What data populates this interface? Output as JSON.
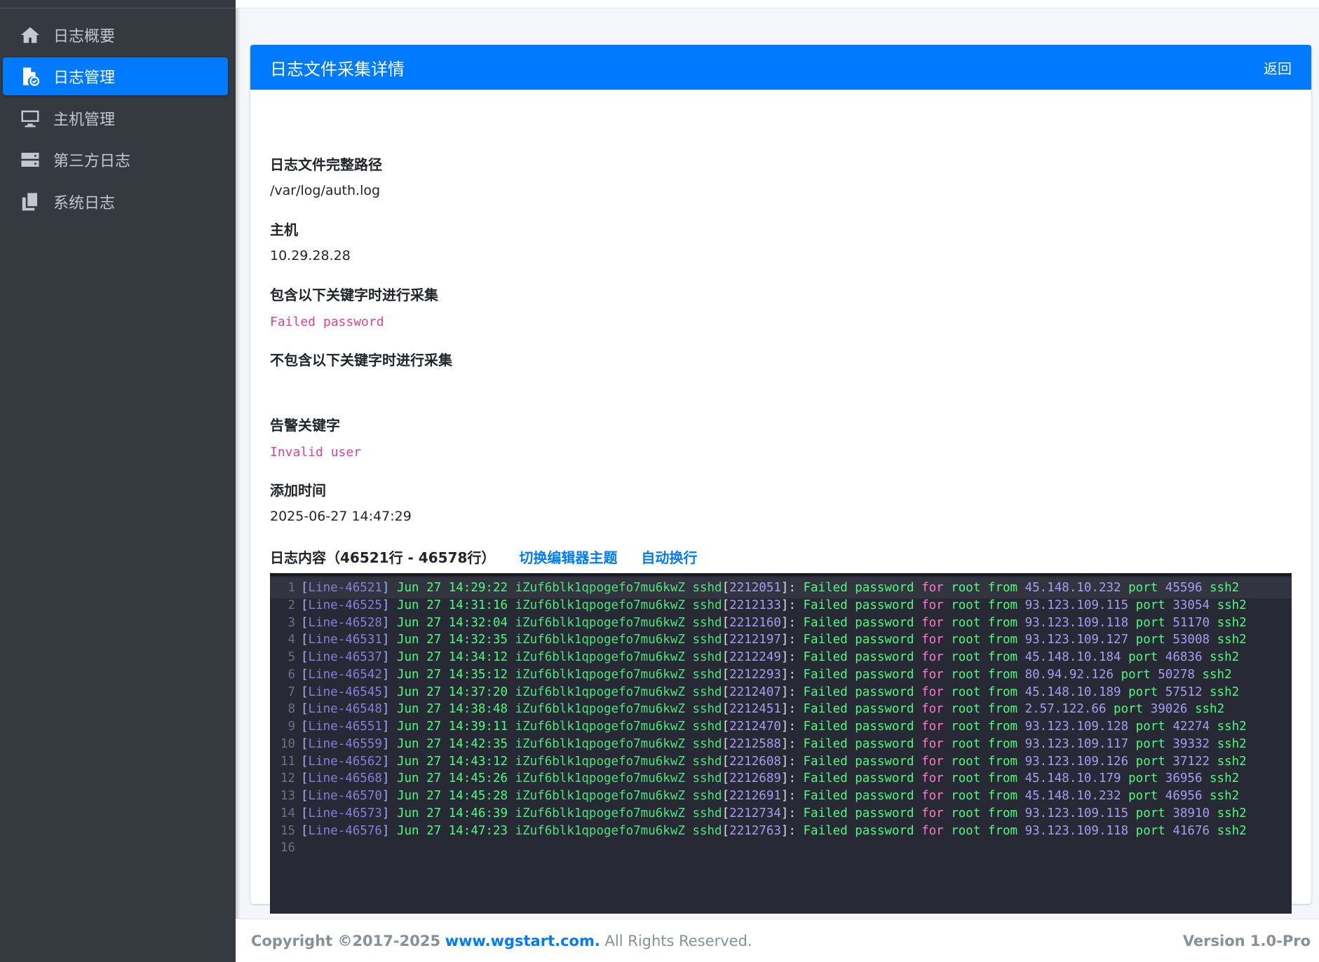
{
  "sidebar": {
    "items": [
      {
        "label": "日志概要",
        "icon": "home-icon"
      },
      {
        "label": "日志管理",
        "icon": "file-check-icon"
      },
      {
        "label": "主机管理",
        "icon": "monitor-icon"
      },
      {
        "label": "第三方日志",
        "icon": "server-icon"
      },
      {
        "label": "系统日志",
        "icon": "copy-icon"
      }
    ],
    "active_index": 1
  },
  "card": {
    "title": "日志文件采集详情",
    "back_label": "返回"
  },
  "fields": {
    "path_label": "日志文件完整路径",
    "path_value": "/var/log/auth.log",
    "host_label": "主机",
    "host_value": "10.29.28.28",
    "include_label": "包含以下关键字时进行采集",
    "include_value": "Failed password",
    "exclude_label": "不包含以下关键字时进行采集",
    "exclude_value": "",
    "alert_label": "告警关键字",
    "alert_value": "Invalid user",
    "added_label": "添加时间",
    "added_value": "2025-06-27 14:47:29"
  },
  "log": {
    "title": "日志内容（46521行 - 46578行）",
    "theme_link": "切换编辑器主题",
    "wrap_link": "自动换行",
    "lines": [
      {
        "n": "1",
        "ln": "Line-46521",
        "time": "14:29:22",
        "pid": "2212051",
        "ip": "45.148.10.232",
        "port": "45596"
      },
      {
        "n": "2",
        "ln": "Line-46525",
        "time": "14:31:16",
        "pid": "2212133",
        "ip": "93.123.109.115",
        "port": "33054"
      },
      {
        "n": "3",
        "ln": "Line-46528",
        "time": "14:32:04",
        "pid": "2212160",
        "ip": "93.123.109.118",
        "port": "51170"
      },
      {
        "n": "4",
        "ln": "Line-46531",
        "time": "14:32:35",
        "pid": "2212197",
        "ip": "93.123.109.127",
        "port": "53008"
      },
      {
        "n": "5",
        "ln": "Line-46537",
        "time": "14:34:12",
        "pid": "2212249",
        "ip": "45.148.10.184",
        "port": "46836"
      },
      {
        "n": "6",
        "ln": "Line-46542",
        "time": "14:35:12",
        "pid": "2212293",
        "ip": "80.94.92.126",
        "port": "50278"
      },
      {
        "n": "7",
        "ln": "Line-46545",
        "time": "14:37:20",
        "pid": "2212407",
        "ip": "45.148.10.189",
        "port": "57512"
      },
      {
        "n": "8",
        "ln": "Line-46548",
        "time": "14:38:48",
        "pid": "2212451",
        "ip": "2.57.122.66",
        "port": "39026"
      },
      {
        "n": "9",
        "ln": "Line-46551",
        "time": "14:39:11",
        "pid": "2212470",
        "ip": "93.123.109.128",
        "port": "42274"
      },
      {
        "n": "10",
        "ln": "Line-46559",
        "time": "14:42:35",
        "pid": "2212588",
        "ip": "93.123.109.117",
        "port": "39332"
      },
      {
        "n": "11",
        "ln": "Line-46562",
        "time": "14:43:12",
        "pid": "2212608",
        "ip": "93.123.109.126",
        "port": "37122"
      },
      {
        "n": "12",
        "ln": "Line-46568",
        "time": "14:45:26",
        "pid": "2212689",
        "ip": "45.148.10.179",
        "port": "36956"
      },
      {
        "n": "13",
        "ln": "Line-46570",
        "time": "14:45:28",
        "pid": "2212691",
        "ip": "45.148.10.232",
        "port": "46956"
      },
      {
        "n": "14",
        "ln": "Line-46573",
        "time": "14:46:39",
        "pid": "2212734",
        "ip": "93.123.109.115",
        "port": "38910"
      },
      {
        "n": "15",
        "ln": "Line-46576",
        "time": "14:47:23",
        "pid": "2212763",
        "ip": "93.123.109.118",
        "port": "41676"
      }
    ],
    "last_line_number": "16",
    "host": "iZuf6blk1qpogefo7mu6kwZ",
    "date": "Jun 27",
    "proc": "sshd",
    "msg": "Failed password",
    "for_kw": "for",
    "user": "root",
    "from_kw": "from",
    "port_kw": "port",
    "proto": "ssh2"
  },
  "footer": {
    "copyright_prefix": "Copyright ©2017-2025",
    "site": "www.wgstart.com.",
    "rights": "All Rights Reserved.",
    "version": "Version 1.0-Pro"
  },
  "colors": {
    "primary": "#007bff",
    "sidebar_bg": "#343a40",
    "editor_bg": "#272935",
    "code_pink": "#e83e8c"
  }
}
